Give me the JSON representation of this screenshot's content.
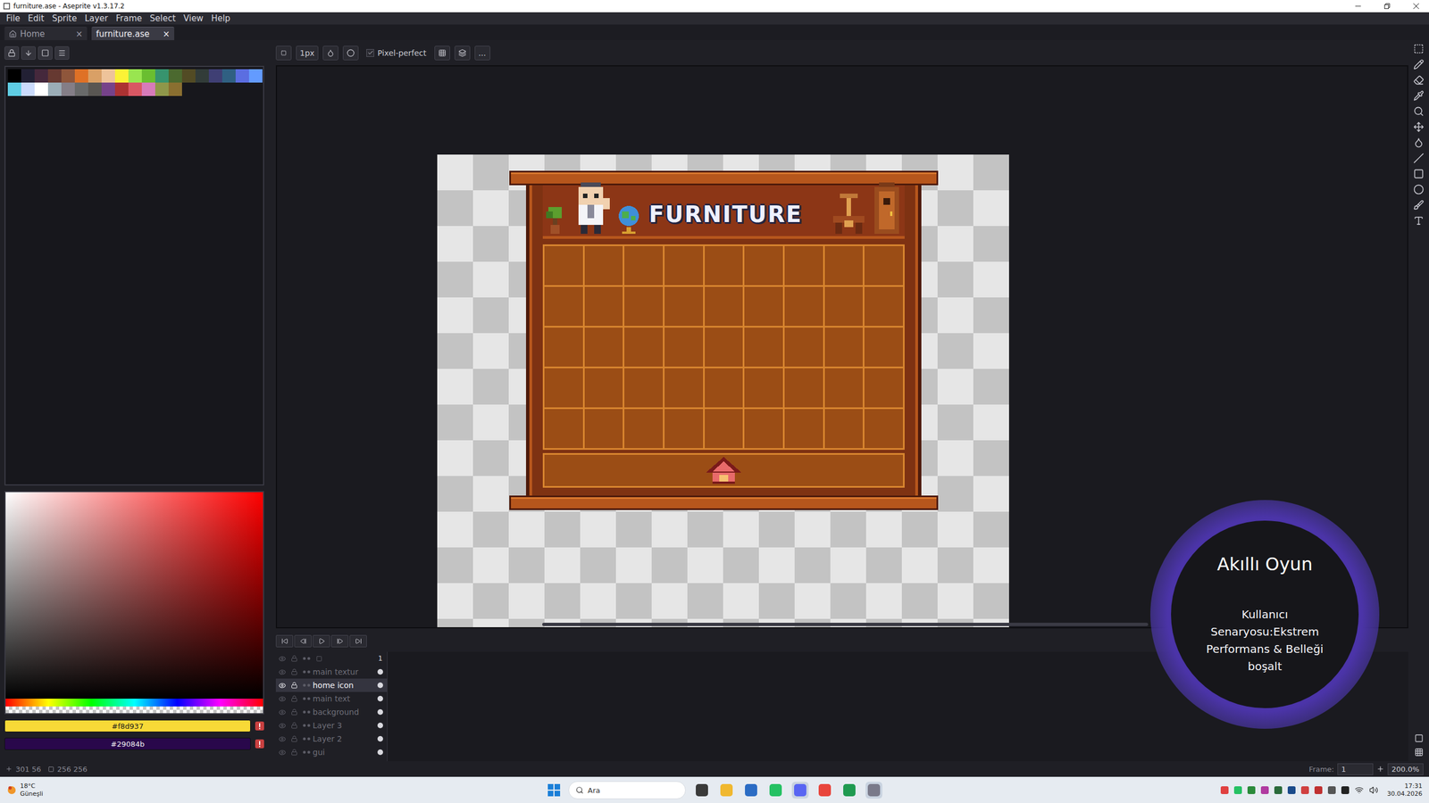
{
  "window": {
    "title": "furniture.ase - Aseprite v1.3.17.2"
  },
  "menu": [
    "File",
    "Edit",
    "Sprite",
    "Layer",
    "Frame",
    "Select",
    "View",
    "Help"
  ],
  "tabs": [
    {
      "label": "Home",
      "selected": false,
      "close": "×"
    },
    {
      "label": "furniture.ase",
      "selected": true,
      "close": "×"
    }
  ],
  "toolbar": {
    "brush_size": "1px",
    "pixel_perfect": {
      "label": "Pixel-perfect",
      "checked": true
    },
    "more": "..."
  },
  "palette": [
    "#000000",
    "#222034",
    "#45283c",
    "#663931",
    "#8f563b",
    "#df7126",
    "#d9a066",
    "#eec39a",
    "#fbf236",
    "#99e550",
    "#6abe30",
    "#37946e",
    "#4b692f",
    "#524b24",
    "#323c39",
    "#3f3f74",
    "#306082",
    "#5b6ee1",
    "#639bff",
    "#5fcde4",
    "#cbdbfc",
    "#ffffff",
    "#9badb7",
    "#847e87",
    "#696a6a",
    "#595652",
    "#76428a",
    "#ac3232",
    "#d95763",
    "#d77bba",
    "#8f974a",
    "#8a6f30"
  ],
  "color_picker": {
    "hue_color": "#ff0000",
    "foreground": "#f8d937",
    "background": "#29084b"
  },
  "sprite": {
    "title": "FURNITURE",
    "columns": 9,
    "rows": 5
  },
  "timeline": {
    "frame_header": "1",
    "layers": [
      {
        "name": "main textur",
        "visible": true,
        "selected": false
      },
      {
        "name": "home icon",
        "visible": true,
        "selected": true
      },
      {
        "name": "main text",
        "visible": true,
        "selected": false
      },
      {
        "name": "background",
        "visible": true,
        "selected": false
      },
      {
        "name": "Layer 3",
        "visible": true,
        "selected": false
      },
      {
        "name": "Layer 2",
        "visible": true,
        "selected": false
      },
      {
        "name": "gui",
        "visible": true,
        "selected": false
      }
    ]
  },
  "status_bar": {
    "position": "301 56",
    "size": "256 256",
    "frame_label": "Frame:",
    "frame": "1",
    "zoom": "200.0%"
  },
  "taskbar": {
    "weather_temp": "18°C",
    "weather_text": "Güneşli",
    "search": "Ara",
    "time": "17:31",
    "date": "30.04.2026"
  },
  "overlay": {
    "title": "Akıllı Oyun",
    "text": "Kullanıcı Senaryosu:Ekstrem Performans & Belleği boşalt"
  }
}
